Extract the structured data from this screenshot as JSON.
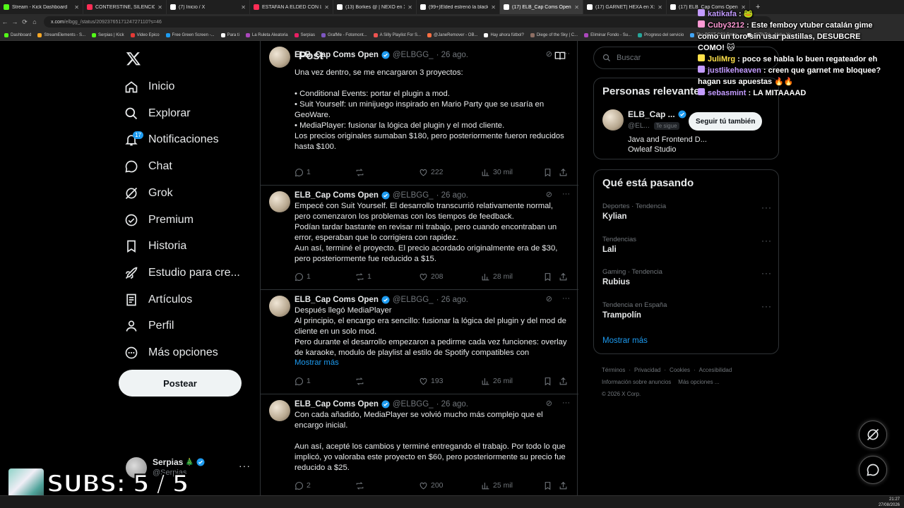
{
  "browser": {
    "tabs": [
      {
        "title": "Stream - Kick Dashboard",
        "color": "#53fc18"
      },
      {
        "title": "CONTERSTINE, SILENCIO Y CH...",
        "color": "#ff2d55"
      },
      {
        "title": "(7) Inicio / X",
        "color": "#ffffff"
      },
      {
        "title": "ESTAFAN A ELDED CON LAS A...",
        "color": "#ff2d55"
      },
      {
        "title": "(13) Borkes @ | NEXO en X: \"N...",
        "color": "#ffffff"
      },
      {
        "title": "(99+)Elded estrenó la blacklist...",
        "color": "#ffffff"
      },
      {
        "title": "(17) ELB_Cap Coms Open en X...",
        "color": "#ffffff"
      },
      {
        "title": "(17) GARNET| HEXA en X: \"Terr...",
        "color": "#ffffff"
      },
      {
        "title": "(17) ELB_Cap Coms Open en X...",
        "color": "#ffffff"
      }
    ],
    "active_tab": 6,
    "url_host": "x.com",
    "url_path": "/elbgg_/status/2092376517124727110?s=46",
    "bookmarks": [
      "Dashboard",
      "StreamElements - S...",
      "Serpias | Kick",
      "Video Epico",
      "Free Green Screen -...",
      "Para ti",
      "La Ruleta Aleatoria",
      "Serpias",
      "GrafMe - Fotomont...",
      "A Silly Playlist For S...",
      "@JaneRemover - OB...",
      "Hay ahora fútbol?",
      "Diege of the Sky | C...",
      "Eliminar Fondo - Su...",
      "Progreso del servicio",
      "The BEST CS2 Settin...",
      "(2)TikTok - Make Yo..."
    ]
  },
  "nav": {
    "items": [
      {
        "label": "Inicio",
        "icon": "home-icon"
      },
      {
        "label": "Explorar",
        "icon": "search-icon"
      },
      {
        "label": "Notificaciones",
        "icon": "bell-icon",
        "badge": "17"
      },
      {
        "label": "Chat",
        "icon": "chat-icon"
      },
      {
        "label": "Grok",
        "icon": "grok-icon"
      },
      {
        "label": "Premium",
        "icon": "premium-icon"
      },
      {
        "label": "Historia",
        "icon": "bookmark-icon"
      },
      {
        "label": "Estudio para cre...",
        "icon": "rocket-icon"
      },
      {
        "label": "Artículos",
        "icon": "article-icon"
      },
      {
        "label": "Perfil",
        "icon": "profile-icon"
      },
      {
        "label": "Más opciones",
        "icon": "more-icon"
      }
    ],
    "post_button": "Postear",
    "account": {
      "name": "Serpias",
      "emoji": "🎄",
      "handle": "@Serpias"
    }
  },
  "main": {
    "title": "Post",
    "tweets": [
      {
        "name": "ELB_Cap Coms Open",
        "handle": "@ELBGG_",
        "time": "· 26 ago.",
        "text": "Una vez dentro, se me encargaron 3 proyectos:\n\n• Conditional Events: portar el plugin a mod.\n• Suit Yourself: un minijuego inspirado en Mario Party que se usaría en GeoWare.\n• MediaPlayer: fusionar la lógica del plugin y el mod cliente.\nLos precios originales sumaban $180, pero posteriormente fueron reducidos hasta $100.",
        "more": "",
        "replies": "1",
        "reposts": "",
        "likes": "222",
        "views": "30 mil"
      },
      {
        "name": "ELB_Cap Coms Open",
        "handle": "@ELBGG_",
        "time": "· 26 ago.",
        "text": "Empecé con Suit Yourself. El desarrollo transcurrió relativamente normal, pero comenzaron los problemas con los tiempos de feedback.\nPodían tardar bastante en revisar mi trabajo, pero cuando encontraban un error, esperaban que lo corrigiera con rapidez.\nAun así, terminé el proyecto. El precio acordado originalmente era de $30, pero posteriormente fue reducido a $15.",
        "more": "",
        "replies": "1",
        "reposts": "1",
        "likes": "208",
        "views": "28 mil"
      },
      {
        "name": "ELB_Cap Coms Open",
        "handle": "@ELBGG_",
        "time": "· 26 ago.",
        "text": "Después llegó MediaPlayer\nAl principio, el encargo era sencillo: fusionar la lógica del plugin y del mod de cliente en un solo mod.\nPero durante el desarrollo empezaron a pedirme cada vez funciones: overlay de karaoke, modulo de playlist al estilo de Spotify compatibles con",
        "more": "Mostrar más",
        "replies": "1",
        "reposts": "",
        "likes": "193",
        "views": "26 mil"
      },
      {
        "name": "ELB_Cap Coms Open",
        "handle": "@ELBGG_",
        "time": "· 26 ago.",
        "text": "Con cada añadido, MediaPlayer se volvió mucho más complejo que el encargo inicial.\n\nAun así, acepté los cambios y terminé entregando el trabajo. Por todo lo que implicó, yo valoraba este proyecto en $60, pero posteriormente su precio fue reducido a $25.",
        "more": "",
        "replies": "2",
        "reposts": "",
        "likes": "200",
        "views": "25 mil"
      }
    ]
  },
  "sidebar": {
    "search_placeholder": "Buscar",
    "relevant": {
      "title": "Personas relevantes",
      "name": "ELB_Cap ...",
      "handle": "@EL...",
      "follows_you": "Te sigue",
      "bio": "Java and Frontend D...",
      "bio2": "Owleaf Studio",
      "follow_back": "Seguir tú también"
    },
    "trends_title": "Qué está pasando",
    "trends": [
      {
        "category": "Deportes · Tendencia",
        "name": "Kylian"
      },
      {
        "category": "Tendencias",
        "name": "Lali"
      },
      {
        "category": "Gaming · Tendencia",
        "name": "Rubius"
      },
      {
        "category": "Tendencia en España",
        "name": "Trampolín"
      }
    ],
    "show_more": "Mostrar más",
    "footer": [
      "Términos",
      "Privacidad",
      "Cookies",
      "Accesibilidad",
      "Información sobre anuncios",
      "Más opciones ...",
      "© 2026 X Corp."
    ]
  },
  "stream_chat": [
    {
      "user": "katikafa",
      "color": "#c39bff",
      "msg": " 🐸"
    },
    {
      "user": "Cuby3212",
      "color": "#ff9ad5",
      "msg": "Este femboy vtuber catalán gime como un toro sin usar pastillas, DESUBCRE COMO! 🐱"
    },
    {
      "user": "JuliMrg",
      "color": "#ffe14a",
      "msg": "poco se habla lo buen regateador eh"
    },
    {
      "user": "justlikeheaven",
      "color": "#c39bff",
      "msg": "creen que garnet me bloquee? hagan sus apuestas 🔥🔥"
    },
    {
      "user": "sebasmint",
      "color": "#c39bff",
      "msg": "LA MITAAAAD"
    }
  ],
  "overlay": {
    "subs": "SUBS: 5 / 5"
  },
  "clock": {
    "time": "21:27",
    "date": "27/08/2026"
  },
  "colors": {
    "accent": "#1d9bf0",
    "bg": "#000000",
    "border": "#2f3336",
    "muted": "#71767b"
  }
}
